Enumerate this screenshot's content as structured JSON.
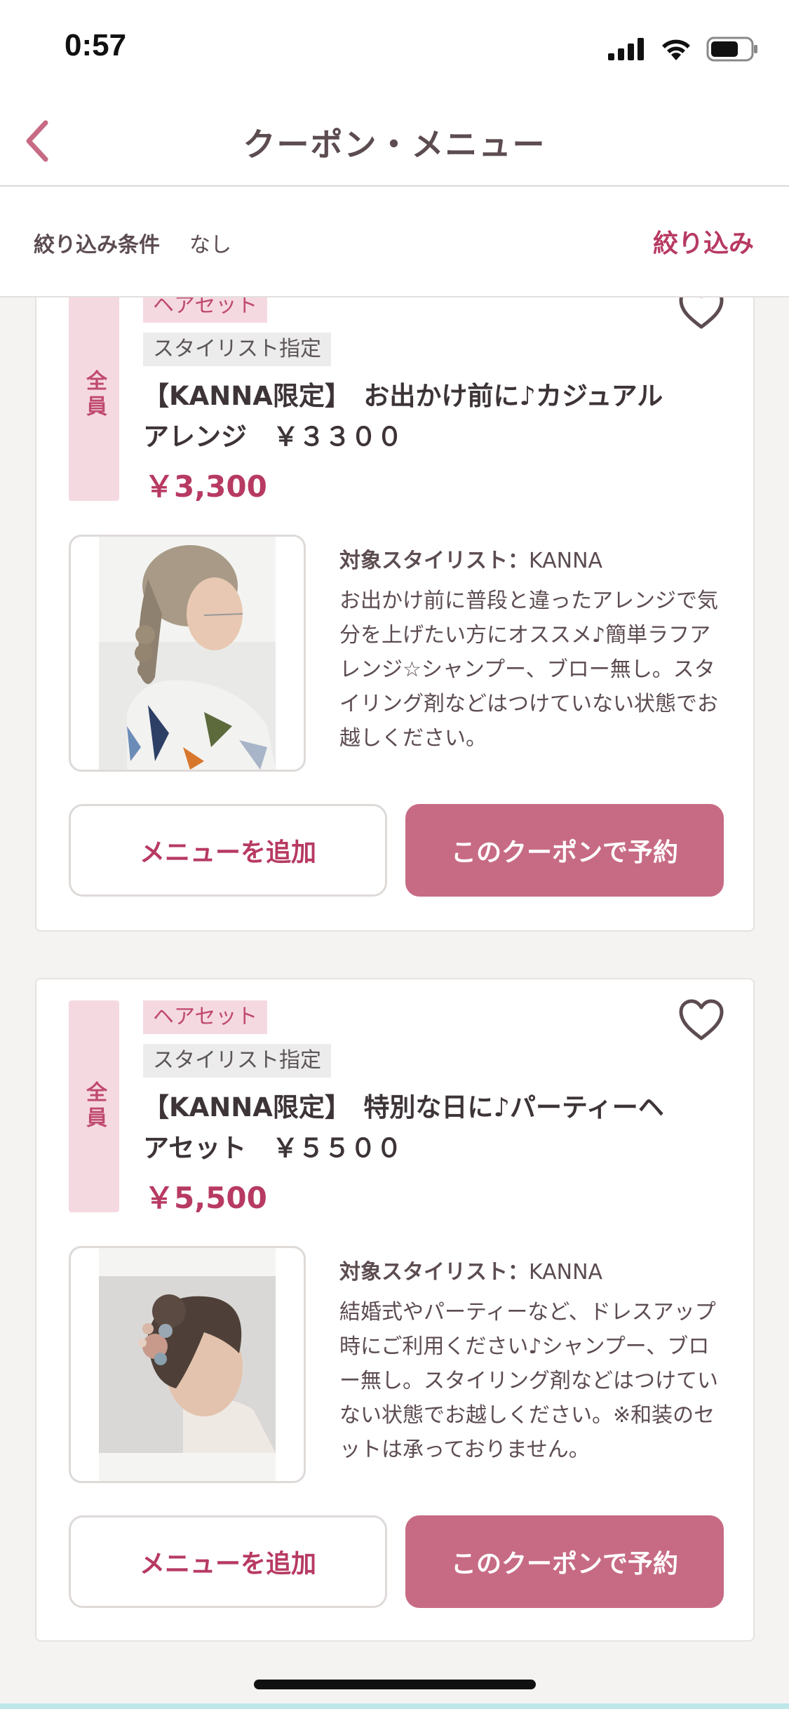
{
  "status": {
    "time": "0:57"
  },
  "nav": {
    "title": "クーポン・メニュー"
  },
  "filter": {
    "label": "絞り込み条件",
    "value": "なし",
    "button": "絞り込み"
  },
  "coupons": [
    {
      "target": "全員",
      "category": "ヘアセット",
      "stylist_tag": "スタイリスト指定",
      "title": "【KANNA限定】　お出かけ前に♪カジュアルアレンジ　￥３３００",
      "price": "￥3,300",
      "stylist_label": "対象スタイリスト：",
      "stylist_name": "KANNA",
      "description": "お出かけ前に普段と違ったアレンジで気分を上げたい方にオススメ♪簡単ラフアレンジ☆シャンプー、ブロー無し。スタイリング剤などはつけていない状態でお越しください。",
      "add_label": "メニューを追加",
      "reserve_label": "このクーポンで予約"
    },
    {
      "target": "全員",
      "category": "ヘアセット",
      "stylist_tag": "スタイリスト指定",
      "title": "【KANNA限定】　特別な日に♪パーティーヘアセット　￥５５００",
      "price": "￥5,500",
      "stylist_label": "対象スタイリスト：",
      "stylist_name": "KANNA",
      "description": "結婚式やパーティーなど、ドレスアップ時にご利用ください♪シャンプー、ブロー無し。スタイリング剤などはつけていない状態でお越しください。※和装のセットは承っておりません。",
      "add_label": "メニューを追加",
      "reserve_label": "このクーポンで予約"
    }
  ],
  "colors": {
    "accent": "#b73a62",
    "reserve_button": "#c76b84",
    "tag_bg": "#f5d9e1"
  }
}
